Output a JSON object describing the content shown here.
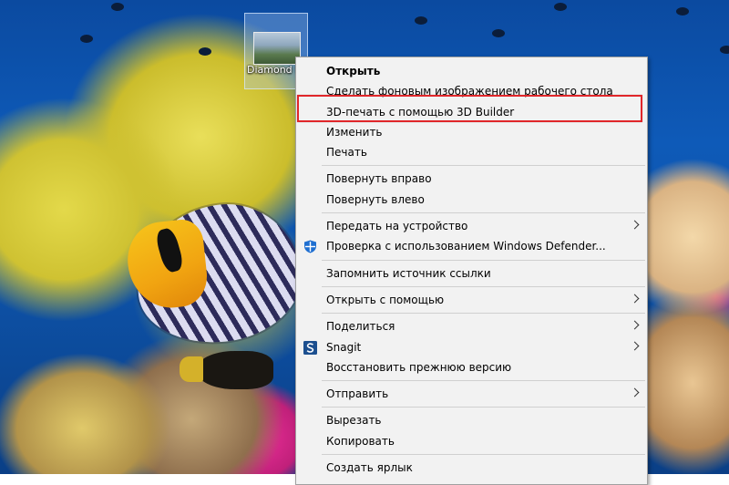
{
  "desktop": {
    "icon": {
      "label": "Diamond Head"
    }
  },
  "menu": {
    "items": [
      {
        "label": "Открыть",
        "bold": true
      },
      {
        "label": "Сделать фоновым изображением рабочего стола"
      },
      {
        "label": "3D-печать с помощью 3D Builder",
        "highlighted": true
      },
      {
        "label": "Изменить"
      },
      {
        "label": "Печать"
      },
      {
        "label": "Повернуть вправо"
      },
      {
        "label": "Повернуть влево"
      },
      {
        "label": "Передать на устройство",
        "submenu": true
      },
      {
        "label": "Проверка с использованием Windows Defender...",
        "icon": "windows-defender-icon"
      },
      {
        "label": "Запомнить источник ссылки"
      },
      {
        "label": "Открыть с помощью",
        "submenu": true
      },
      {
        "label": "Поделиться",
        "submenu": true
      },
      {
        "label": "Snagit",
        "icon": "snagit-icon",
        "submenu": true
      },
      {
        "label": "Восстановить прежнюю версию"
      },
      {
        "label": "Отправить",
        "submenu": true
      },
      {
        "label": "Вырезать"
      },
      {
        "label": "Копировать"
      },
      {
        "label": "Создать ярлык"
      }
    ]
  },
  "colors": {
    "menu_background": "#f2f2f2",
    "highlight_frame": "#e0262a",
    "defender_blue": "#1f6fd1",
    "snagit_blue": "#1c4f8f"
  }
}
